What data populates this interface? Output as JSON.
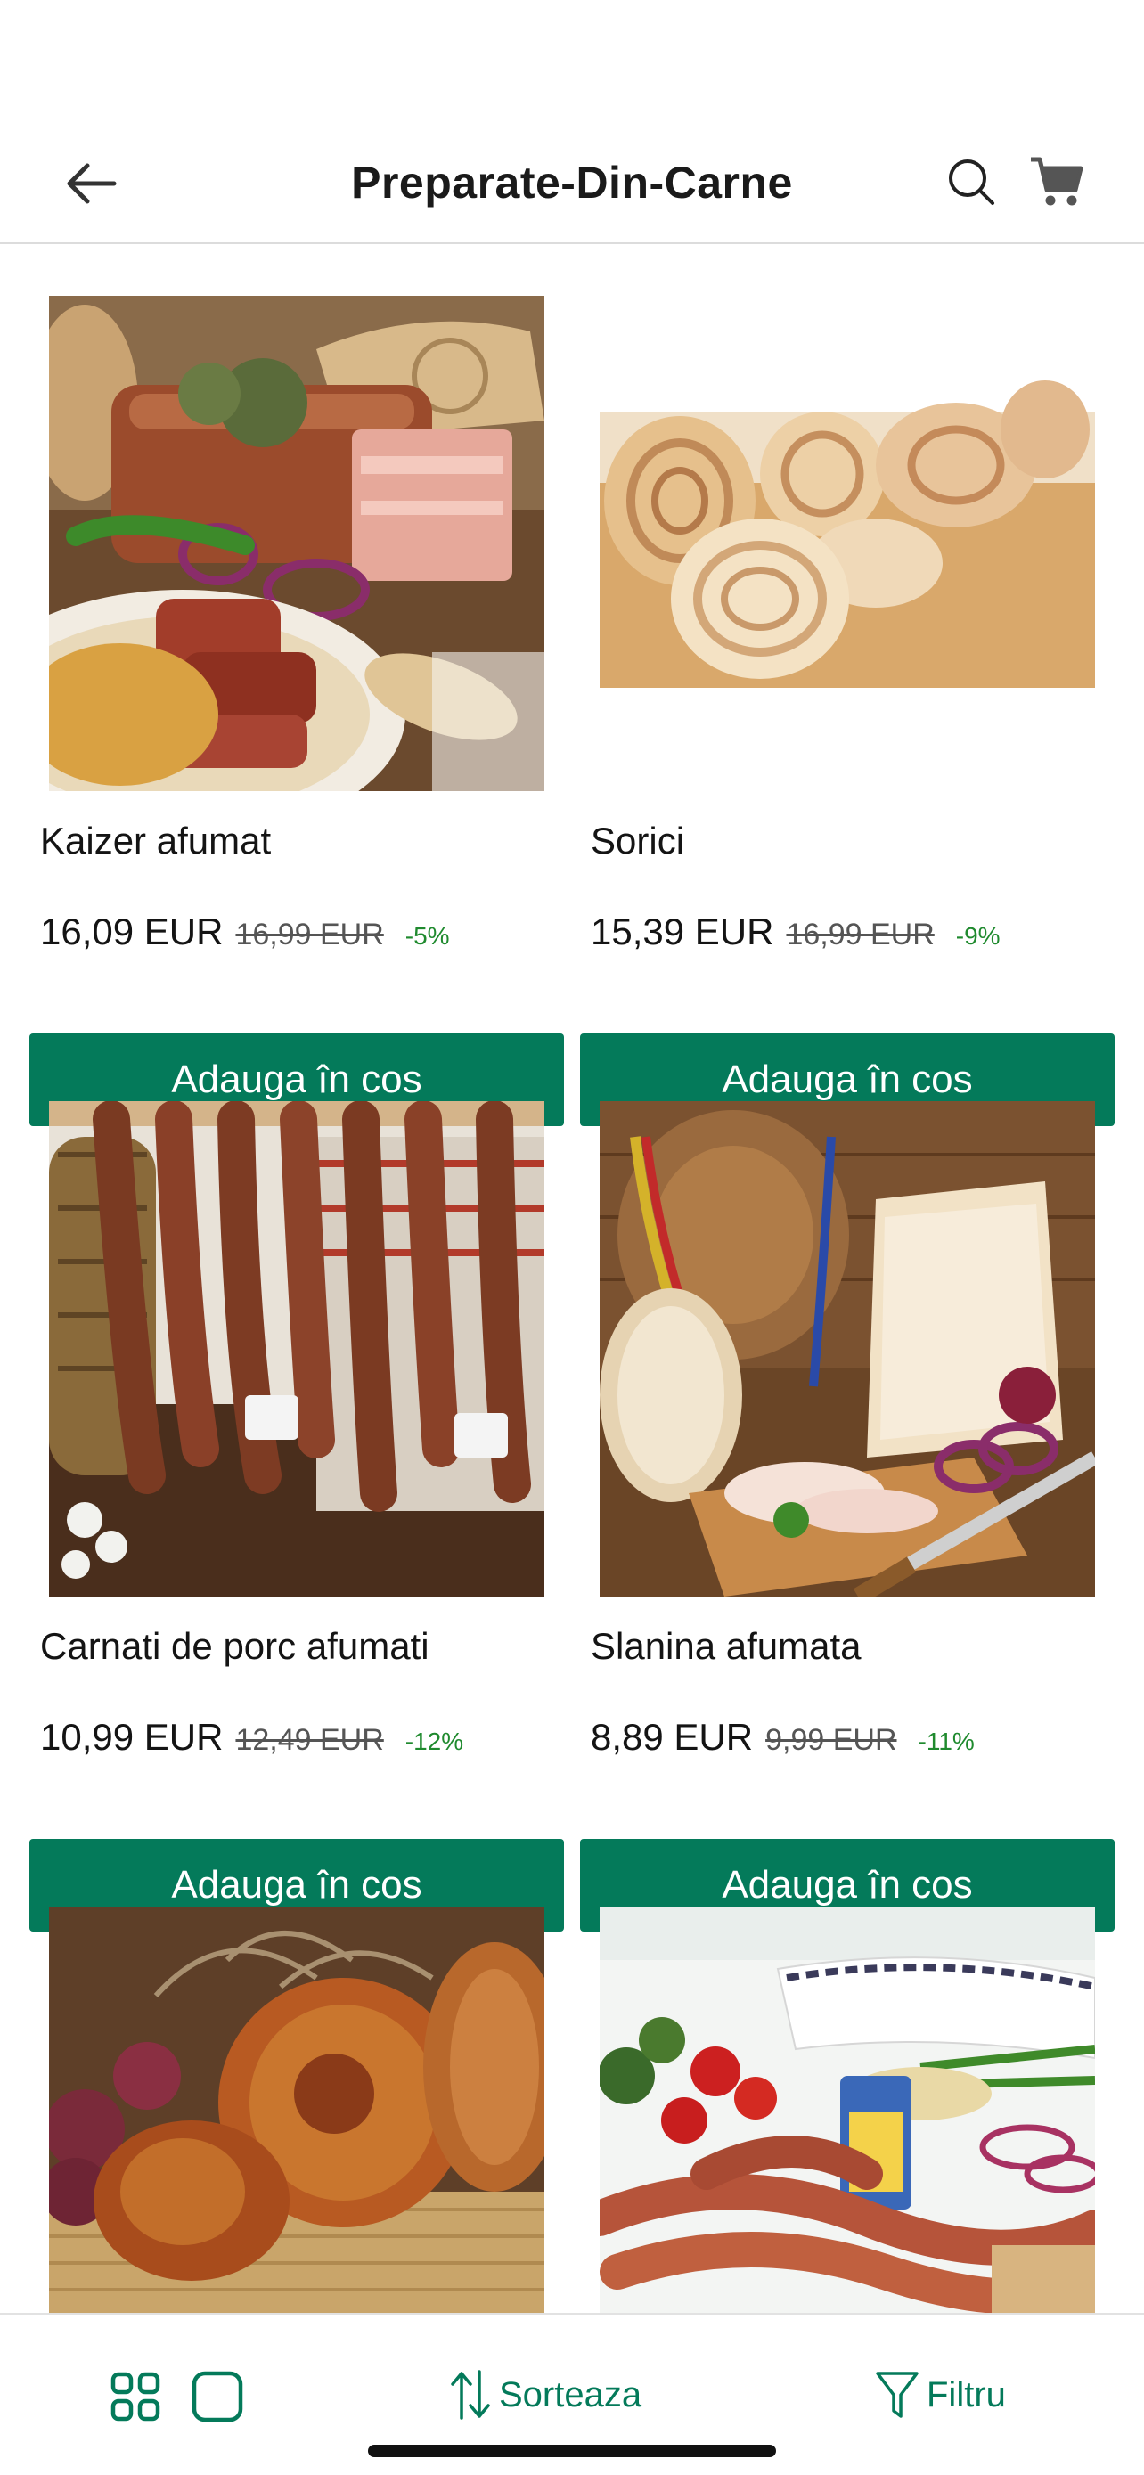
{
  "header": {
    "title": "Preparate-Din-Carne",
    "back_icon": "arrow-left-icon",
    "search_icon": "search-icon",
    "cart_icon": "cart-icon"
  },
  "products": [
    {
      "name": "Kaizer afumat",
      "price": "16,09 EUR",
      "old_price": "16,99 EUR",
      "discount": "-5%",
      "button": "Adauga în cos"
    },
    {
      "name": "Sorici",
      "price": "15,39 EUR",
      "old_price": "16,99 EUR",
      "discount": "-9%",
      "button": "Adauga în cos"
    },
    {
      "name": "Carnati de porc afumati",
      "price": "10,99 EUR",
      "old_price": "12,49 EUR",
      "discount": "-12%",
      "button": "Adauga în cos"
    },
    {
      "name": "Slanina afumata",
      "price": "8,89 EUR",
      "old_price": "9,99 EUR",
      "discount": "-11%",
      "button": "Adauga în cos"
    },
    {
      "name": "",
      "price": "",
      "old_price": "",
      "discount": "",
      "button": ""
    },
    {
      "name": "",
      "price": "",
      "old_price": "",
      "discount": "",
      "button": ""
    }
  ],
  "bottom_bar": {
    "sort_label": "Sorteaza",
    "filter_label": "Filtru",
    "grid_view_icon": "grid-view-icon",
    "single_view_icon": "single-view-icon",
    "sort_icon": "sort-arrows-icon",
    "filter_icon": "funnel-icon"
  },
  "colors": {
    "accent": "#047a5a",
    "discount": "#1f8a2e"
  }
}
